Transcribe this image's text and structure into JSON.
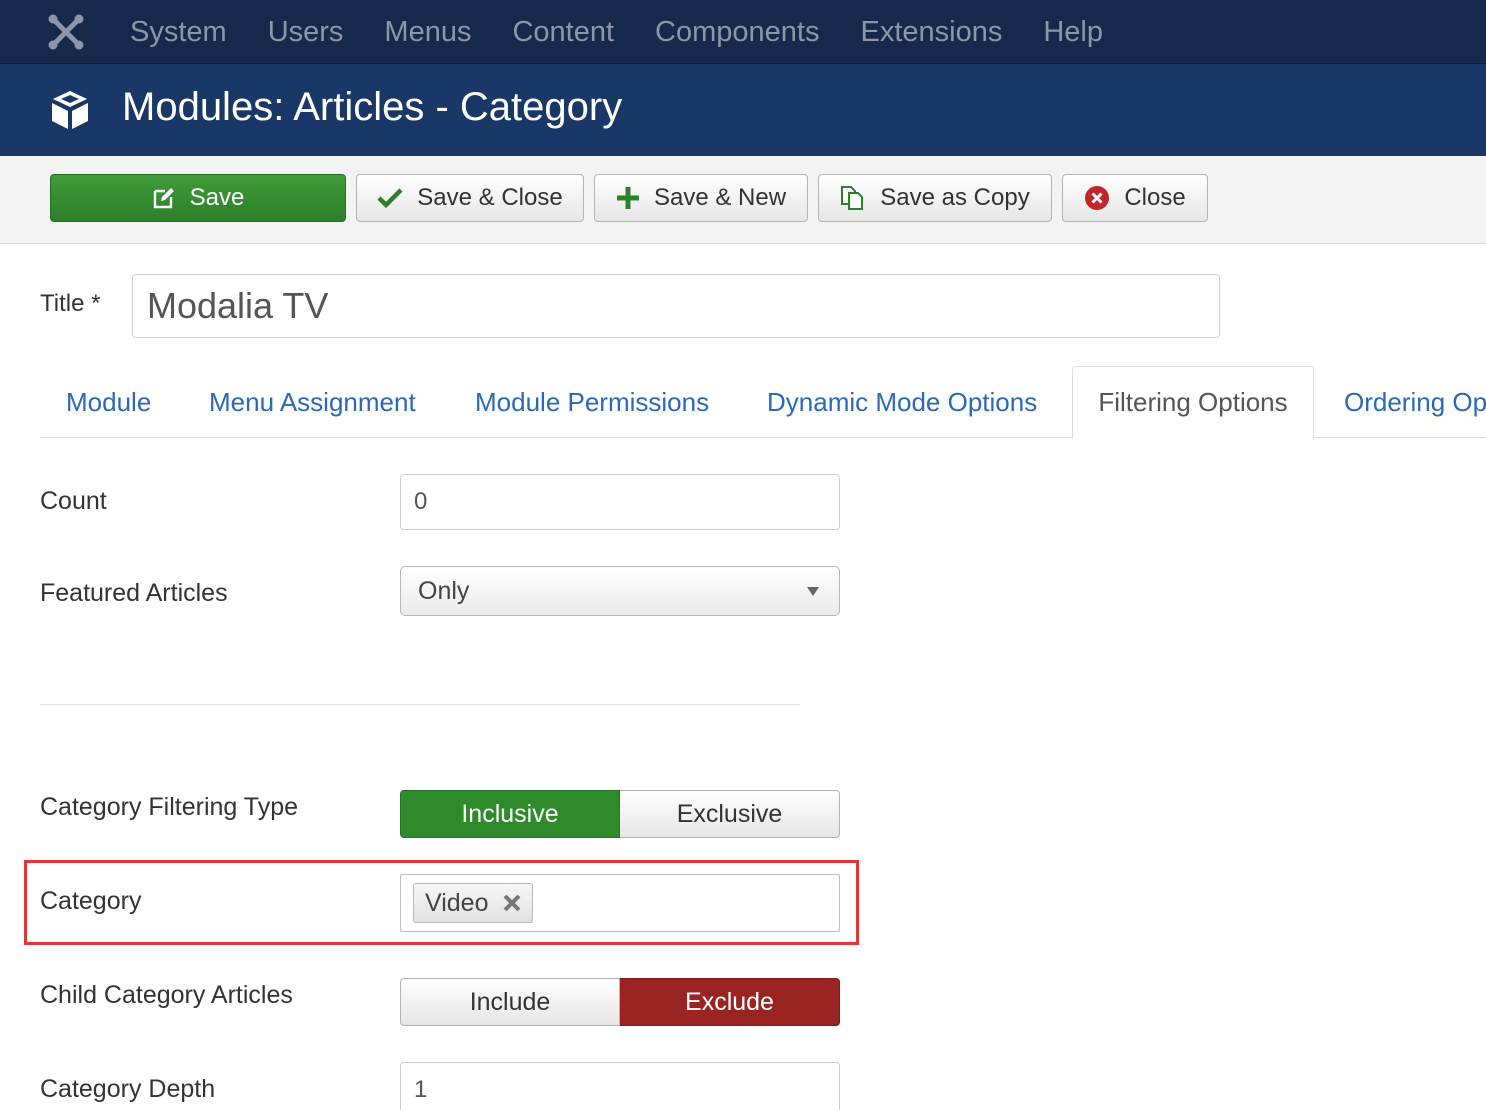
{
  "navbar": {
    "menu": [
      "System",
      "Users",
      "Menus",
      "Content",
      "Components",
      "Extensions",
      "Help"
    ]
  },
  "header": {
    "title": "Modules: Articles - Category"
  },
  "toolbar": {
    "save_label": "Save",
    "save_close_label": "Save & Close",
    "save_new_label": "Save & New",
    "save_copy_label": "Save as Copy",
    "close_label": "Close"
  },
  "title_field": {
    "label": "Title *",
    "value": "Modalia TV"
  },
  "tabs": [
    {
      "label": "Module",
      "active": false
    },
    {
      "label": "Menu Assignment",
      "active": false
    },
    {
      "label": "Module Permissions",
      "active": false
    },
    {
      "label": "Dynamic Mode Options",
      "active": false
    },
    {
      "label": "Filtering Options",
      "active": true
    },
    {
      "label": "Ordering Op",
      "active": false
    }
  ],
  "fields": {
    "count": {
      "label": "Count",
      "value": "0"
    },
    "featured": {
      "label": "Featured Articles",
      "value": "Only"
    },
    "filtering_type": {
      "label": "Category Filtering Type",
      "options": [
        "Inclusive",
        "Exclusive"
      ],
      "selected": "Inclusive"
    },
    "category": {
      "label": "Category",
      "tags": [
        "Video"
      ]
    },
    "child_articles": {
      "label": "Child Category Articles",
      "options": [
        "Include",
        "Exclude"
      ],
      "selected": "Exclude"
    },
    "depth": {
      "label": "Category Depth",
      "value": "1"
    }
  },
  "colors": {
    "navbar_bg": "#17294a",
    "header_bg": "#1a3867",
    "save_green": "#2d7f2a",
    "active_green": "#2f8a2c",
    "exclude_red": "#9a2421",
    "highlight_red": "#e8333a",
    "link_blue": "#2a69b8"
  },
  "icons": {
    "navbar_logo": "joomla-logo-icon",
    "header": "cube-icon",
    "save": "edit-icon",
    "save_close": "checkmark-icon",
    "save_new": "plus-icon",
    "save_copy": "copy-icon",
    "close": "close-circle-icon",
    "tag_remove": "close-icon",
    "select": "caret-down-icon"
  }
}
